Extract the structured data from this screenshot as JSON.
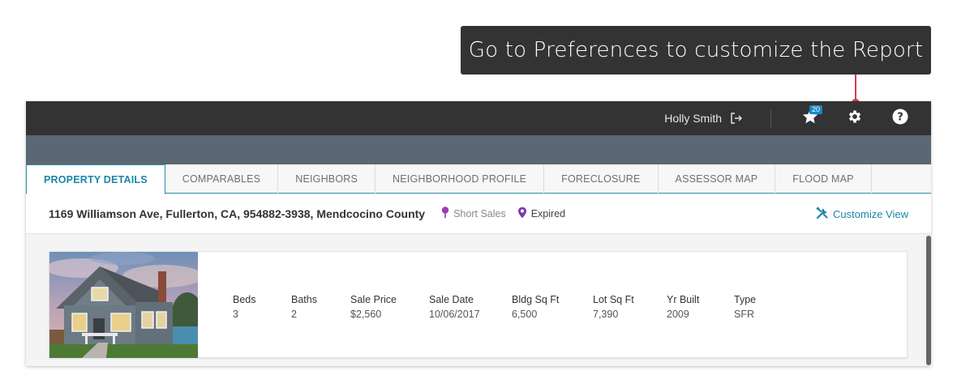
{
  "tooltip": {
    "text": "Go to Preferences to customize the Report"
  },
  "header": {
    "user_name": "Holly Smith",
    "favorites_count": "20"
  },
  "tabs": [
    {
      "label": "PROPERTY DETAILS",
      "active": true
    },
    {
      "label": "COMPARABLES"
    },
    {
      "label": "NEIGHBORS"
    },
    {
      "label": "NEIGHBORHOOD PROFILE"
    },
    {
      "label": "FORECLOSURE"
    },
    {
      "label": "ASSESSOR MAP"
    },
    {
      "label": "FLOOD MAP"
    }
  ],
  "property": {
    "address": "1169 Williamson Ave, Fullerton, CA, 954882-3938, Mendcocino County",
    "status_short_sales": "Short Sales",
    "status_expired": "Expired",
    "customize_label": "Customize View"
  },
  "stats": [
    {
      "label": "Beds",
      "value": "3"
    },
    {
      "label": "Baths",
      "value": "2"
    },
    {
      "label": "Sale Price",
      "value": "$2,560"
    },
    {
      "label": "Sale Date",
      "value": "10/06/2017"
    },
    {
      "label": "Bldg Sq Ft",
      "value": "6,500"
    },
    {
      "label": "Lot Sq Ft",
      "value": "7,390"
    },
    {
      "label": "Yr Built",
      "value": "2009"
    },
    {
      "label": "Type",
      "value": "SFR"
    }
  ],
  "colors": {
    "accent": "#1d86a8",
    "topbar": "#333333",
    "subbar": "#5c6774",
    "pointer": "#d43b4f",
    "short_sales_pin": "#9b3fb5",
    "expired_pin": "#7d3aa6"
  }
}
